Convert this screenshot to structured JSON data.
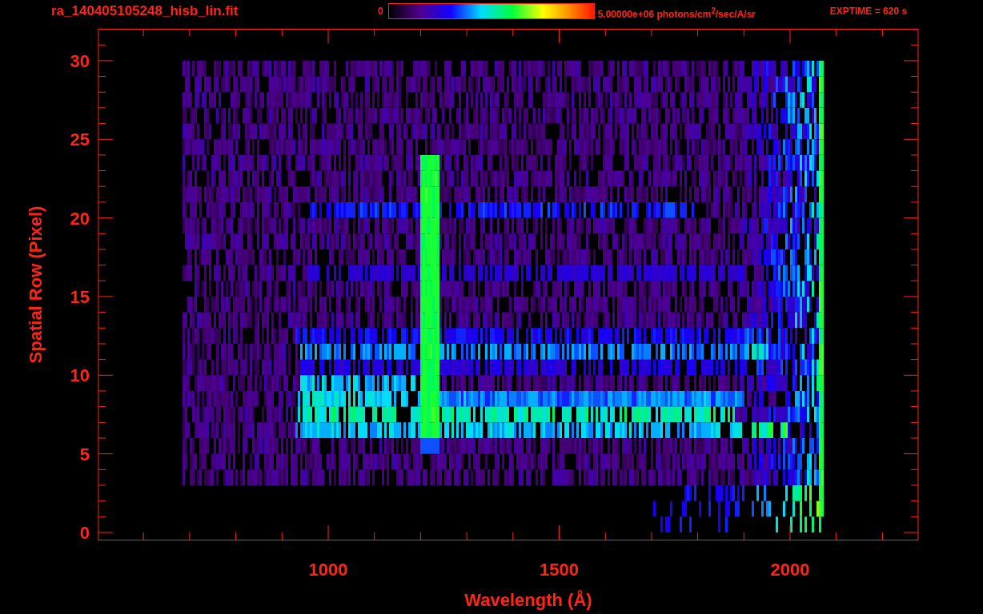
{
  "title": "ra_140405105248_hisb_lin.fit",
  "colorbar": {
    "min_label": "0",
    "max_label": "5.00000e+06 photons/cm$^{2}$/sec/A/sr"
  },
  "exptime": "EXPTIME = 620 s",
  "plot": {
    "xlabel": "Wavelength (Å)",
    "ylabel": "Spatial Row (Pixel)",
    "xticks": [
      "1000",
      "1500",
      "2000"
    ],
    "yticks": [
      "30",
      "25",
      "20",
      "15",
      "10",
      "5",
      "0"
    ]
  }
}
